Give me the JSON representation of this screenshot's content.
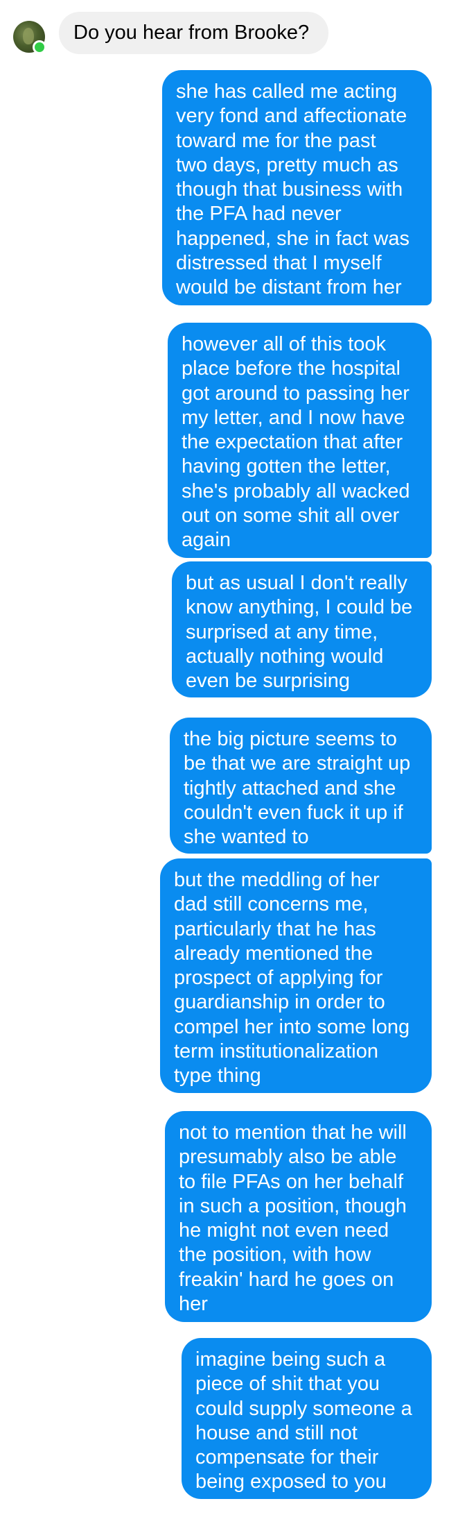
{
  "contact": {
    "avatar_icon": "avatar-plant-icon",
    "online": true,
    "presence_color": "#31cc46"
  },
  "colors": {
    "incoming_bubble": "#f0f0f0",
    "outgoing_bubble": "#0a8cf0",
    "outgoing_text": "#ffffff"
  },
  "messages": [
    {
      "sender": "contact",
      "text": "Do you hear from Brooke?"
    },
    {
      "sender": "me",
      "text": "she has called me acting\nvery fond and affectionate\ntoward me for the past\ntwo days, pretty much as\nthough that business with\nthe PFA had never\nhappened, she in fact was\ndistressed that I myself\nwould be distant from her"
    },
    {
      "sender": "me",
      "text": "however all of this took\nplace before the hospital\ngot around to passing her\nmy letter, and I now have\nthe expectation that after\nhaving gotten the letter,\nshe's probably all wacked\nout on some shit all over\nagain"
    },
    {
      "sender": "me",
      "text": "but as usual I don't really\nknow anything, I could be\nsurprised at any time,\nactually nothing would\neven be surprising"
    },
    {
      "sender": "me",
      "text": "the big picture seems to\nbe that we are straight up\ntightly attached and she\ncouldn't even fuck it up if\nshe wanted to"
    },
    {
      "sender": "me",
      "text": "but the meddling of her\ndad still concerns me,\nparticularly that he has\nalready mentioned the\nprospect of applying for\nguardianship in order to\ncompel her into some long\nterm institutionalization\ntype thing"
    },
    {
      "sender": "me",
      "text": "not to mention that he will\npresumably also be able\nto file PFAs on her behalf\nin such a position, though\nhe might not even need\nthe position, with how\nfreakin' hard he goes on\nher"
    },
    {
      "sender": "me",
      "text": "imagine being such a\npiece of shit that you\ncould supply someone a\nhouse and still not\ncompensate for their\nbeing exposed to you"
    }
  ]
}
